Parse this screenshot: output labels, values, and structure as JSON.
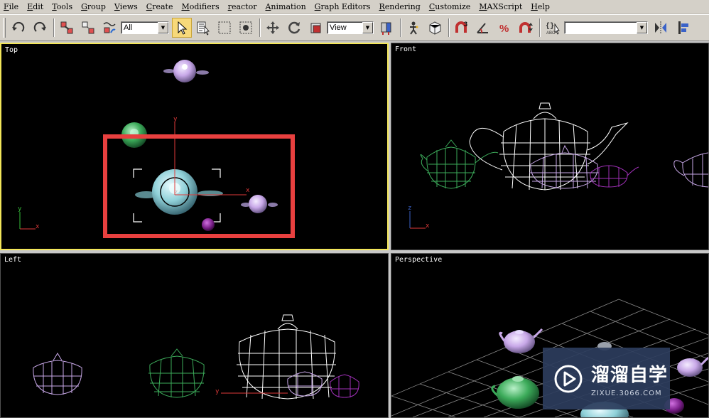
{
  "menubar": {
    "items": [
      "File",
      "Edit",
      "Tools",
      "Group",
      "Views",
      "Create",
      "Modifiers",
      "reactor",
      "Animation",
      "Graph Editors",
      "Rendering",
      "Customize",
      "MAXScript",
      "Help"
    ]
  },
  "toolbar": {
    "selection_filter": "All",
    "reference_coord": "View",
    "named_selection": "",
    "icons": [
      "undo-icon",
      "redo-icon",
      "select-and-link-icon",
      "unlink-icon",
      "bind-space-warp-icon",
      "select-object-icon",
      "select-by-name-icon",
      "rectangular-region-icon",
      "window-crossing-icon",
      "move-icon",
      "rotate-icon",
      "scale-icon",
      "pivot-icon",
      "select-manipulate-icon",
      "keyboard-shortcut-icon",
      "snap-toggle-icon",
      "angle-snap-icon",
      "percent-snap-icon",
      "spinner-snap-icon",
      "edit-named-selection-icon",
      "mirror-icon",
      "align-icon"
    ]
  },
  "viewports": {
    "top": {
      "label": "Top"
    },
    "front": {
      "label": "Front"
    },
    "left": {
      "label": "Left"
    },
    "perspective": {
      "label": "Perspective"
    }
  },
  "axes": {
    "x": "x",
    "y": "y",
    "z": "z"
  },
  "colors": {
    "active_border": "#f3e65a",
    "highlight_box": "#e8403f",
    "teapot_cyan": "#8fd0d8",
    "teapot_green": "#3cab5a",
    "teapot_lilac": "#c8a8e8",
    "teapot_purple": "#7a1f8a",
    "wireframe_white": "#ffffff"
  },
  "watermark": {
    "title": "溜溜自学",
    "url": "ZIXUE.3066.COM"
  }
}
